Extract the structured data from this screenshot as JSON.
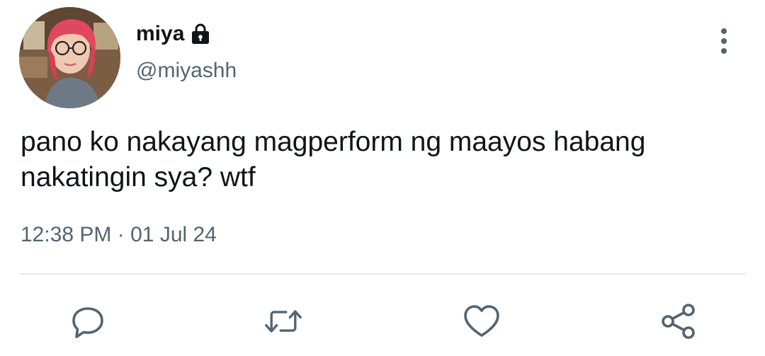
{
  "tweet": {
    "display_name": "miya",
    "handle": "@miyashh",
    "text": "pano ko nakayang magperform ng maayos habang nakatingin sya? wtf",
    "time": "12:38 PM",
    "separator": "·",
    "date": "01 Jul 24"
  },
  "icons": {
    "protected": "lock-icon",
    "more": "more-vertical-icon",
    "reply": "reply-icon",
    "retweet": "retweet-icon",
    "like": "heart-icon",
    "share": "share-icon"
  },
  "colors": {
    "text_primary": "#0f1419",
    "text_secondary": "#536471",
    "icon": "#536471",
    "divider": "#e6e9eb"
  }
}
